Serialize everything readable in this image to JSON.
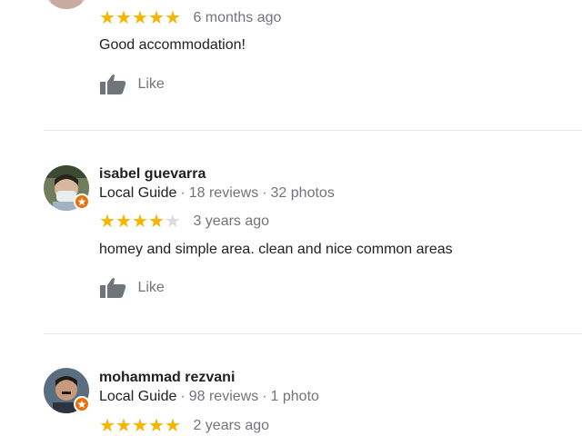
{
  "reviews": [
    {
      "name": "",
      "stars": 5,
      "time": "6 months ago",
      "text": "Good accommodation!",
      "like_label": "Like"
    },
    {
      "name": "isabel guevarra",
      "local_guide_label": "Local Guide",
      "reviews_count": "18 reviews",
      "photos_count": "32 photos",
      "separator": "·",
      "stars": 4,
      "time": "3 years ago",
      "text": "homey and simple area. clean and nice common areas",
      "like_label": "Like"
    },
    {
      "name": "mohammad rezvani",
      "local_guide_label": "Local Guide",
      "reviews_count": "98 reviews",
      "photos_count": "1 photo",
      "separator": "·",
      "stars": 5,
      "time": "2 years ago"
    }
  ],
  "colors": {
    "star_on": "#f4b400",
    "star_off": "#dadce0",
    "badge": "#e8710a",
    "secondary_text": "#70757a",
    "primary_text": "#202124"
  },
  "icons": {
    "star": "star-icon",
    "like": "thumbs-up-icon",
    "badge": "local-guide-badge-icon"
  }
}
